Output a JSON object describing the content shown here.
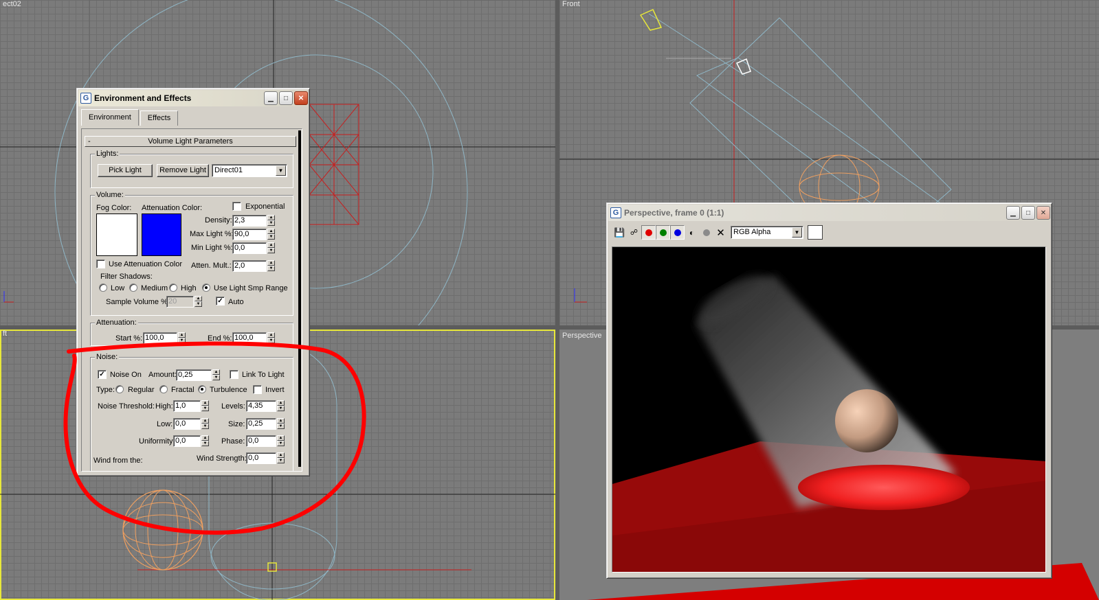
{
  "viewports": {
    "top_label": "ect02",
    "front_label": "Front",
    "left_label": "ft",
    "persp_label": "Perspective"
  },
  "env_window": {
    "title": "Environment and Effects",
    "tabs": [
      "Environment",
      "Effects"
    ],
    "rollout_title": "Volume Light Parameters",
    "rollout_toggle": "-",
    "lights": {
      "group_label": "Lights:",
      "pick_light": "Pick Light",
      "remove_light": "Remove Light",
      "selected_light": "Direct01"
    },
    "volume": {
      "group_label": "Volume:",
      "fog_color_label": "Fog Color:",
      "fog_color": "#ffffff",
      "atten_color_label": "Attenuation Color:",
      "atten_color": "#0000ff",
      "exponential_label": "Exponential",
      "exponential_checked": false,
      "density_label": "Density:",
      "density": "2,3",
      "max_light_label": "Max Light %:",
      "max_light": "90,0",
      "min_light_label": "Min Light %:",
      "min_light": "0,0",
      "use_atten_label": "Use Attenuation Color",
      "use_atten_checked": false,
      "atten_mult_label": "Atten. Mult.:",
      "atten_mult": "2,0",
      "filter_shadows_label": "Filter Shadows:",
      "filter_options": [
        "Low",
        "Medium",
        "High",
        "Use Light Smp Range"
      ],
      "filter_selected": "Use Light Smp Range",
      "sample_volume_label": "Sample Volume %:",
      "sample_volume": "20",
      "auto_label": "Auto",
      "auto_checked": true
    },
    "attenuation": {
      "group_label": "Attenuation:",
      "start_label": "Start %:",
      "start": "100,0",
      "end_label": "End %:",
      "end": "100,0"
    },
    "noise": {
      "group_label": "Noise:",
      "noise_on_label": "Noise On",
      "noise_on_checked": true,
      "amount_label": "Amount:",
      "amount": "0,25",
      "link_label": "Link To Light",
      "link_checked": false,
      "type_label": "Type:",
      "type_options": [
        "Regular",
        "Fractal",
        "Turbulence"
      ],
      "type_selected": "Turbulence",
      "invert_label": "Invert",
      "invert_checked": false,
      "threshold_label": "Noise Threshold:",
      "high_label": "High:",
      "high": "1,0",
      "levels_label": "Levels:",
      "levels": "4,35",
      "low_label": "Low:",
      "low": "0,0",
      "size_label": "Size:",
      "size": "0,25",
      "uniformity_label": "Uniformity:",
      "uniformity": "0,0",
      "phase_label": "Phase:",
      "phase": "0,0",
      "wind_from_label": "Wind from the:",
      "wind_strength_label": "Wind Strength:",
      "wind_strength": "0,0"
    }
  },
  "render_window": {
    "title": "Perspective, frame 0 (1:1)",
    "channel": "RGB Alpha",
    "channel_colors": {
      "red": "#e00000",
      "green": "#008000",
      "blue": "#0000e0"
    }
  },
  "colors": {
    "annotation": "#ff0000",
    "viewport_bg": "#7b7b7b",
    "active_viewport": "#e8e83a"
  }
}
